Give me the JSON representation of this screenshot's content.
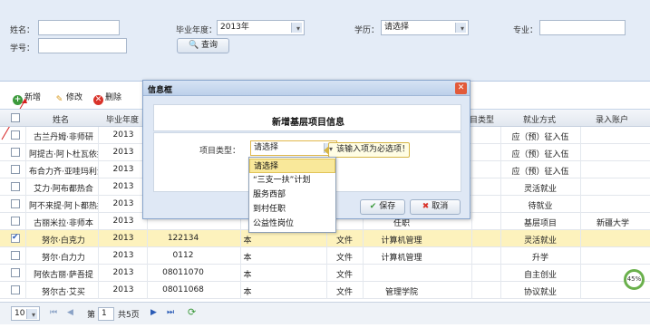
{
  "search": {
    "name_label": "姓名：",
    "year_label": "毕业年度：",
    "year_value": "2013年",
    "edu_label": "学历：",
    "edu_value": "请选择",
    "major_label": "专业：",
    "id_label": "学号：",
    "query_label": "查询"
  },
  "toolbar": {
    "add": "新增",
    "edit": "修改",
    "delete": "删除"
  },
  "grid": {
    "headers": [
      "姓名",
      "毕业年度",
      "项目类型",
      "就业方式",
      "录入账户"
    ],
    "rows": [
      {
        "name": "古兰丹姆·非师研",
        "year": "2013",
        "sid": "",
        "c4": "",
        "c5": "",
        "type": "",
        "mode": "应（预）征入伍",
        "account": "",
        "checked": false,
        "selected": false
      },
      {
        "name": "阿提古·阿卜杜瓦依提",
        "year": "2013",
        "sid": "",
        "c4": "",
        "c5": "",
        "type": "",
        "mode": "应（预）征入伍",
        "account": "",
        "checked": false,
        "selected": false
      },
      {
        "name": "布合力齐·亚哇玛利江",
        "year": "2013",
        "sid": "",
        "c4": "",
        "c5": "",
        "type": "",
        "mode": "应（预）征入伍",
        "account": "",
        "checked": false,
        "selected": false
      },
      {
        "name": "艾力·阿布都热合",
        "year": "2013",
        "sid": "",
        "c4": "",
        "c5": "",
        "type": "",
        "mode": "灵活就业",
        "account": "",
        "checked": false,
        "selected": false
      },
      {
        "name": "阿不来提·阿卜都热提",
        "year": "2013",
        "sid": "",
        "c4": "",
        "c5": "",
        "type": "",
        "mode": "待就业",
        "account": "",
        "checked": false,
        "selected": false
      },
      {
        "name": "古丽米拉·非师本",
        "year": "2013",
        "sid": "",
        "c4": "",
        "c5": "",
        "type": "任职",
        "mode": "基层项目",
        "account": "新疆大学",
        "checked": false,
        "selected": false
      },
      {
        "name": "努尔·白克力",
        "year": "2013",
        "sid": "122134",
        "c4": "本",
        "c5": "文件",
        "type": "计算机管理",
        "mode": "灵活就业",
        "account": "",
        "checked": true,
        "selected": true
      },
      {
        "name": "努尔·白力力",
        "year": "2013",
        "sid": "0112",
        "c4": "本",
        "c5": "文件",
        "type": "计算机管理",
        "mode": "升学",
        "account": "",
        "checked": false,
        "selected": false
      },
      {
        "name": "阿依古丽·萨吾提",
        "year": "2013",
        "sid": "08011070",
        "c4": "本",
        "c5": "文件",
        "type": "",
        "mode": "自主创业",
        "account": "",
        "checked": false,
        "selected": false
      },
      {
        "name": "努尔古·艾买",
        "year": "2013",
        "sid": "08011068",
        "c4": "本",
        "c5": "文件",
        "type": "管理学院",
        "mode": "协议就业",
        "account": "",
        "checked": false,
        "selected": false
      }
    ],
    "hidden_header": "目类型"
  },
  "pager": {
    "page_size": "10",
    "page_label": "第",
    "page_value": "1",
    "total_label": "共5页"
  },
  "modal": {
    "title": "信息框",
    "heading": "新增基层项目信息",
    "field_label": "项目类型：",
    "field_value": "请选择",
    "tip": "该输入项为必选项！",
    "save": "保存",
    "cancel": "取消",
    "options": [
      "请选择",
      "“三支一扶”计划",
      "服务西部",
      "到村任职",
      "公益性岗位"
    ]
  },
  "badge": {
    "value": "45%"
  },
  "colors": {
    "accent": "#2a5bb6",
    "selected_row": "#fdf2bd",
    "tip_border": "#d6b547",
    "badge": "#6ab04c"
  }
}
